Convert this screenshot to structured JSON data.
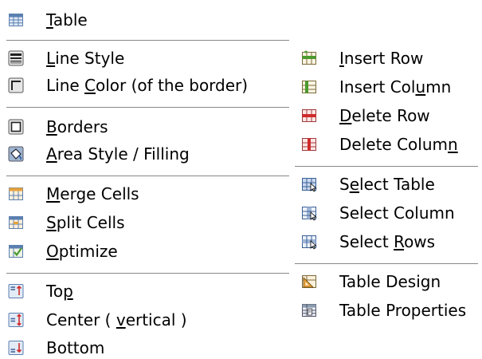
{
  "left_menu": {
    "table": {
      "pre": "",
      "u": "T",
      "post": "able",
      "icon": "table-icon"
    },
    "line_style": {
      "pre": "",
      "u": "L",
      "post": "ine Style",
      "icon": "line-style-icon"
    },
    "line_color": {
      "pre": "Line ",
      "u": "C",
      "post": "olor (of the border)",
      "icon": "line-color-icon"
    },
    "borders": {
      "pre": "",
      "u": "B",
      "post": "orders",
      "icon": "borders-icon"
    },
    "area_style": {
      "pre": "",
      "u": "A",
      "post": "rea Style / Filling",
      "icon": "area-style-icon"
    },
    "merge_cells": {
      "pre": "",
      "u": "M",
      "post": "erge Cells",
      "icon": "merge-cells-icon"
    },
    "split_cells": {
      "pre": "",
      "u": "S",
      "post": "plit Cells",
      "icon": "split-cells-icon"
    },
    "optimize": {
      "pre": "",
      "u": "O",
      "post": "ptimize",
      "icon": "optimize-icon"
    },
    "top": {
      "pre": "To",
      "u": "p",
      "post": "",
      "icon": "align-top-icon"
    },
    "center": {
      "pre": "Center ( ",
      "u": "v",
      "post": "ertical )",
      "icon": "align-center-vertical-icon"
    },
    "bottom": {
      "pre": "Bottom",
      "u": "",
      "post": "",
      "icon": "align-bottom-icon"
    }
  },
  "right_menu": {
    "insert_row": {
      "pre": "",
      "u": "I",
      "post": "nsert Row",
      "icon": "insert-row-icon"
    },
    "insert_column": {
      "pre": "Insert Col",
      "u": "u",
      "post": "mn",
      "icon": "insert-column-icon"
    },
    "delete_row": {
      "pre": "",
      "u": "D",
      "post": "elete Row",
      "icon": "delete-row-icon"
    },
    "delete_column": {
      "pre": "Delete Colum",
      "u": "n",
      "post": "",
      "icon": "delete-column-icon"
    },
    "select_table": {
      "pre": "S",
      "u": "e",
      "post": "lect Table",
      "icon": "select-table-icon"
    },
    "select_column": {
      "pre": "Select Column",
      "u": "",
      "post": "",
      "icon": "select-column-icon"
    },
    "select_rows": {
      "pre": "Select ",
      "u": "R",
      "post": "ows",
      "icon": "select-rows-icon"
    },
    "table_design": {
      "pre": "Table Design",
      "u": "",
      "post": "",
      "icon": "table-design-icon"
    },
    "table_properties": {
      "pre": "Table Properties",
      "u": "",
      "post": "",
      "icon": "table-properties-icon"
    }
  },
  "colors": {
    "separator": "#888888",
    "grid_blue": "#5b7fb0",
    "grid_green": "#4a9a2e",
    "grid_red": "#d02a2a",
    "grid_orange": "#e8a23a"
  }
}
